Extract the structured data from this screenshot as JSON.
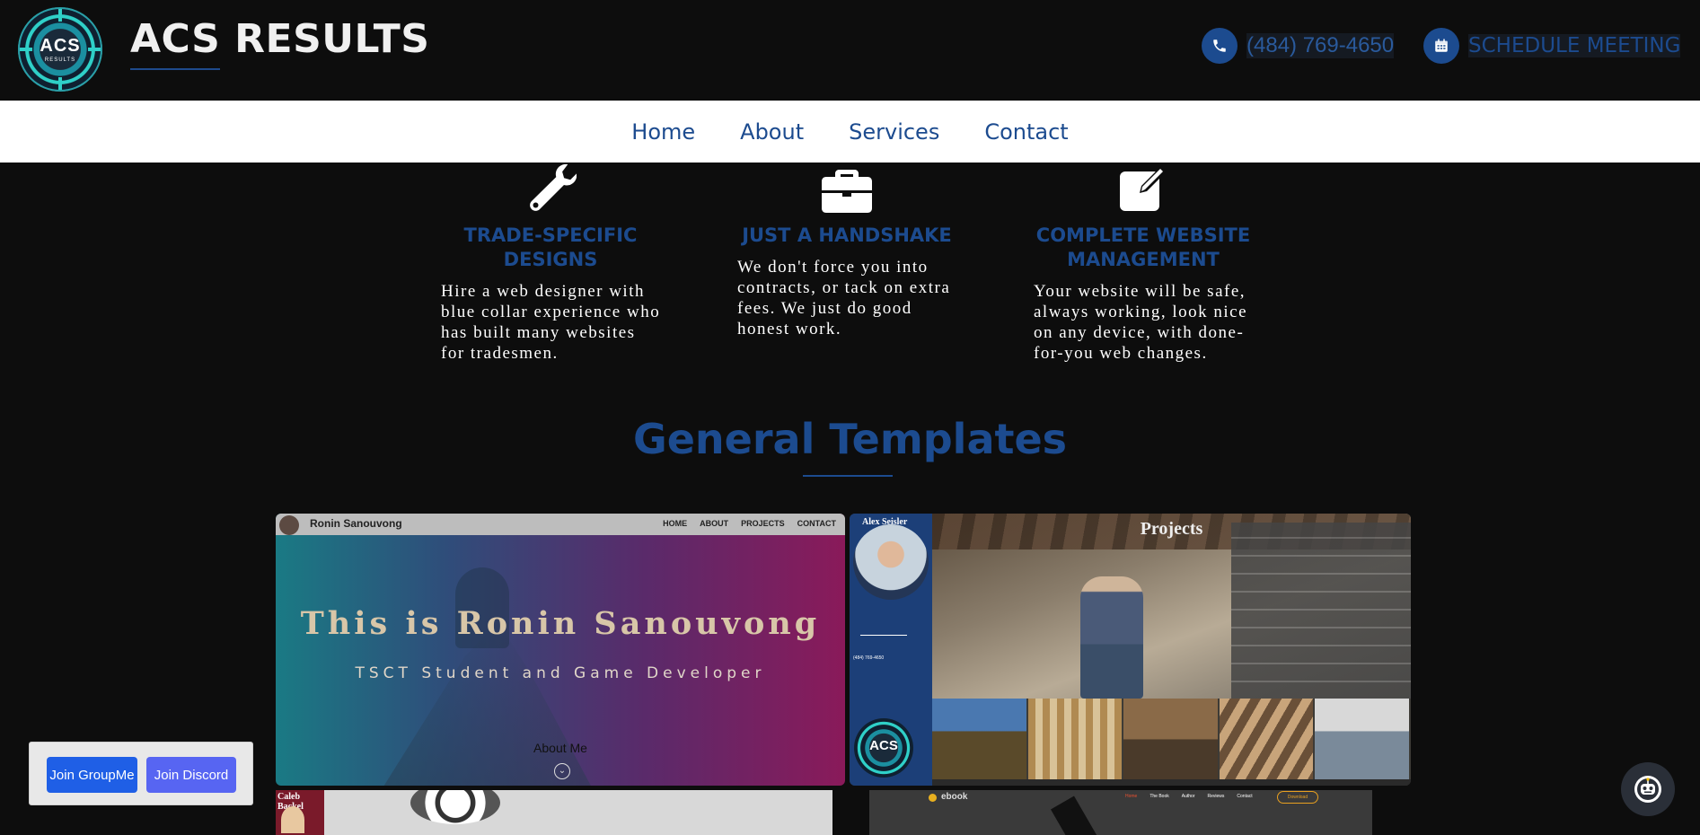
{
  "header": {
    "logo_text": "ACS",
    "logo_subtext": "RESULTS",
    "brand": "ACS RESULTS",
    "phone": "(484) 769-4650",
    "schedule": "SCHEDULE MEETING"
  },
  "nav": {
    "items": [
      "Home",
      "About",
      "Services",
      "Contact"
    ]
  },
  "features": [
    {
      "icon": "wrench-icon",
      "title": "TRADE-SPECIFIC DESIGNS",
      "text": "Hire a web designer with blue collar experience who has built many websites for tradesmen."
    },
    {
      "icon": "briefcase-icon",
      "title": "JUST A HANDSHAKE",
      "text": "We don't force you into contracts, or tack on extra fees. We just do good honest work."
    },
    {
      "icon": "edit-icon",
      "title": "COMPLETE WEBSITE MANAGEMENT",
      "text": "Your website will be safe, always working, look nice on any device, with done-for-you web changes."
    }
  ],
  "templates": {
    "title": "General Templates",
    "card1": {
      "name": "Ronin Sanouvong",
      "links": [
        "HOME",
        "ABOUT",
        "PROJECTS",
        "CONTACT"
      ],
      "headline": "This is Ronin Sanouvong",
      "subheadline": "TSCT Student and Game Developer",
      "about": "About Me"
    },
    "card2": {
      "name": "Alex Seisler",
      "heading": "Projects",
      "info": "(484) 769-4650",
      "logo_text": "ACS"
    },
    "card3": {
      "name": "Caleb Backel"
    },
    "card4": {
      "brand": "ebook",
      "links": [
        "Home",
        "The Book",
        "Author",
        "Reviews",
        "Contact"
      ],
      "download": "Download"
    }
  },
  "widgets": {
    "groupme": "Join GroupMe",
    "discord": "Join Discord"
  },
  "colors": {
    "accent": "#1c4b8f",
    "background": "#0d0d0d",
    "groupme": "#1f5fe6",
    "discord": "#5765f2"
  }
}
